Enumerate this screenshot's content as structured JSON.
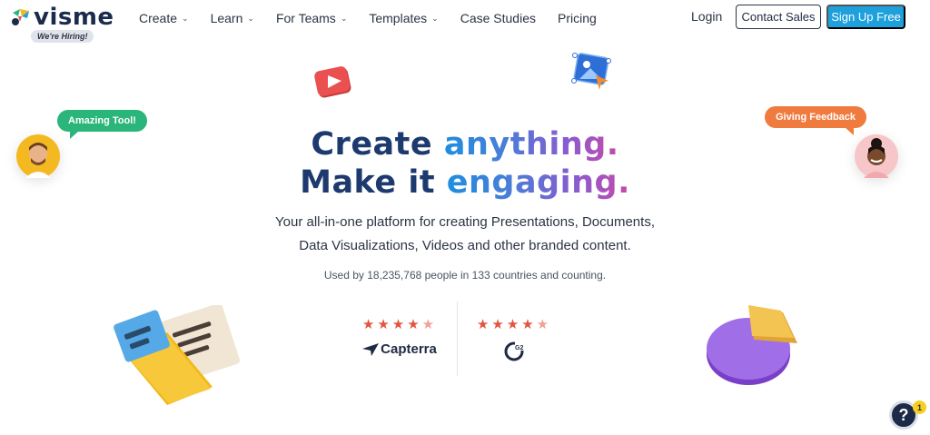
{
  "nav": {
    "logo_text": "visme",
    "hiring_badge": "We're Hiring!",
    "menu": [
      {
        "label": "Create",
        "has_dropdown": true
      },
      {
        "label": "Learn",
        "has_dropdown": true
      },
      {
        "label": "For Teams",
        "has_dropdown": true
      },
      {
        "label": "Templates",
        "has_dropdown": true
      },
      {
        "label": "Case Studies",
        "has_dropdown": false
      },
      {
        "label": "Pricing",
        "has_dropdown": false
      }
    ],
    "login": "Login",
    "contact_sales": "Contact Sales",
    "sign_up": "Sign Up Free"
  },
  "hero": {
    "line1_a": "Create",
    "line1_b": "anything.",
    "line2_a": "Make it",
    "line2_b": "engaging.",
    "sub_line1": "Your all-in-one platform for creating Presentations, Documents,",
    "sub_line2": "Data Visualizations, Videos and other branded content.",
    "used_by": "Used by 18,235,768 people in 133 countries and counting."
  },
  "ratings": [
    {
      "brand": "Capterra",
      "stars": 4.5,
      "icon": "capterra-arrow-icon"
    },
    {
      "brand": "G2",
      "stars": 4.5,
      "icon": "g2-logo-icon"
    }
  ],
  "bubbles": {
    "left": "Amazing Tool!",
    "right": "Giving Feedback"
  },
  "help": {
    "label": "?",
    "badge": "1"
  },
  "colors": {
    "brand_blue": "#1ea0dc",
    "headline_dark": "#1d3a6e",
    "star_red": "#e2553f",
    "bubble_green": "#2ab57a",
    "bubble_orange": "#f07b3f"
  }
}
